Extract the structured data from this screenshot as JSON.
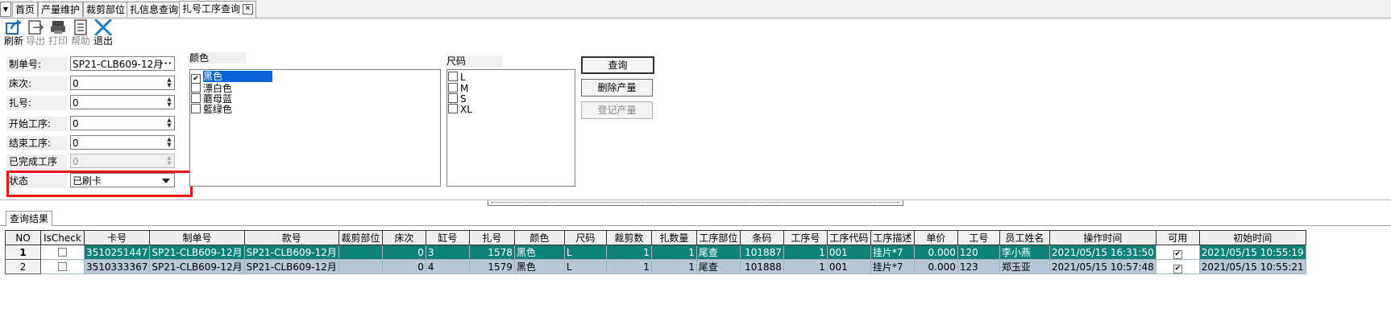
{
  "tabs": [
    {
      "label": "首页"
    },
    {
      "label": "产量维护"
    },
    {
      "label": "裁剪部位"
    },
    {
      "label": "扎信息查询"
    },
    {
      "label": "扎号工序查询"
    }
  ],
  "toolbar": {
    "refresh": "刷新",
    "export": "导出",
    "print": "打印",
    "help": "帮助",
    "exit": "退出"
  },
  "form": {
    "order_label": "制单号:",
    "order_value": "SP21-CLB609-12月",
    "bed_label": "床次:",
    "bed_value": "0",
    "bundle_label": "扎号:",
    "bundle_value": "0",
    "start_label": "开始工序:",
    "start_value": "0",
    "end_label": "结束工序:",
    "end_value": "0",
    "done_label": "已完成工序",
    "done_value": "0",
    "status_label": "状态",
    "status_value": "已刷卡"
  },
  "colors": {
    "label": "颜色",
    "items": [
      {
        "text": "黑色",
        "checked": true,
        "selected": true
      },
      {
        "text": "漂白色",
        "checked": false
      },
      {
        "text": "蘑母蓝",
        "checked": false
      },
      {
        "text": "藍绿色",
        "checked": false
      }
    ]
  },
  "sizes": {
    "label": "尺码",
    "items": [
      {
        "text": "L"
      },
      {
        "text": "M"
      },
      {
        "text": "S"
      },
      {
        "text": "XL"
      }
    ]
  },
  "buttons": {
    "query": "查询",
    "delete": "删除产量",
    "register": "登记产量"
  },
  "results": {
    "tab_label": "查询结果",
    "headers": [
      "NO",
      "IsCheck",
      "卡号",
      "制单号",
      "款号",
      "裁剪部位",
      "床次",
      "缸号",
      "扎号",
      "颜色",
      "尺码",
      "裁剪数",
      "扎数量",
      "工序部位",
      "条码",
      "工序号",
      "工序代码",
      "工序描述",
      "单价",
      "工号",
      "员工姓名",
      "操作时间",
      "可用",
      "初始时间"
    ],
    "rows": [
      [
        "1",
        "",
        "3510251447",
        "SP21-CLB609-12月",
        "SP21-CLB609-12月",
        "",
        "0",
        "3",
        "1578",
        "黑色",
        "L",
        "1",
        "1",
        "尾查",
        "101887",
        "1",
        "001",
        "挂片*7",
        "0.000",
        "120",
        "李小燕",
        "2021/05/15 16:31:50",
        "✔",
        "2021/05/15 10:55:19"
      ],
      [
        "2",
        "",
        "3510333367",
        "SP21-CLB609-12月",
        "SP21-CLB609-12月",
        "",
        "0",
        "4",
        "1579",
        "黑色",
        "L",
        "1",
        "1",
        "尾查",
        "101888",
        "1",
        "001",
        "挂片*7",
        "0.000",
        "123",
        "郑玉亚",
        "2021/05/15 10:57:48",
        "✔",
        "2021/05/15 10:55:21"
      ]
    ]
  },
  "accent": {
    "row_selected": "#0d8376",
    "row_alt": "#b9c8d4",
    "highlight": "#ee1111",
    "list_select": "#0a64d6"
  }
}
